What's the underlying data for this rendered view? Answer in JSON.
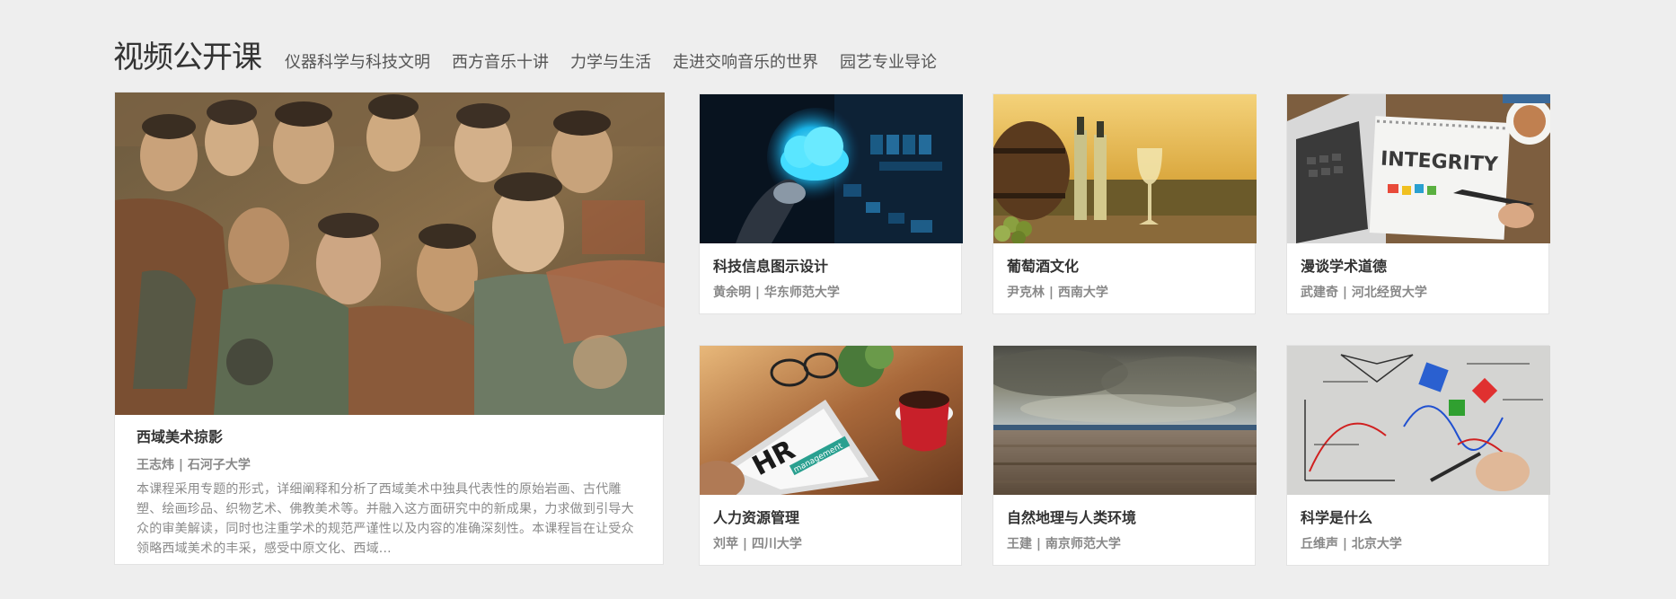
{
  "header": {
    "title": "视频公开课",
    "tabs": [
      {
        "label": "仪器科学与科技文明"
      },
      {
        "label": "西方音乐十讲"
      },
      {
        "label": "力学与生活"
      },
      {
        "label": "走进交响音乐的世界"
      },
      {
        "label": "园艺专业导论"
      }
    ]
  },
  "featured": {
    "title": "西域美术掠影",
    "meta": "王志炜 | 石河子大学",
    "description": "本课程采用专题的形式，详细阐释和分析了西域美术中独具代表性的原始岩画、古代雕塑、绘画珍品、织物艺术、佛教美术等。并融入这方面研究中的新成果，力求做到引导大众的审美解读，同时也注重学术的规范严谨性以及内容的准确深刻性。本课程旨在让受众领略西域美术的丰采，感受中原文化、西域...",
    "image": "buddhist-mural-image"
  },
  "courses": [
    {
      "title": "科技信息图示设计",
      "meta": "黄余明 | 华东师范大学",
      "image": "cloud-technology-image"
    },
    {
      "title": "葡萄酒文化",
      "meta": "尹克林 | 西南大学",
      "image": "wine-barrel-image"
    },
    {
      "title": "漫谈学术道德",
      "meta": "武建奇 | 河北经贸大学",
      "image": "integrity-notebook-image"
    },
    {
      "title": "人力资源管理",
      "meta": "刘苹 | 四川大学",
      "image": "hr-tablet-image"
    },
    {
      "title": "自然地理与人类环境",
      "meta": "王建 | 南京师范大学",
      "image": "landscape-image"
    },
    {
      "title": "科学是什么",
      "meta": "丘维声 | 北京大学",
      "image": "science-formula-image"
    }
  ],
  "images": {
    "integrity_word": "INTEGRITY",
    "hr_word": "HR",
    "hr_sub": "management"
  }
}
